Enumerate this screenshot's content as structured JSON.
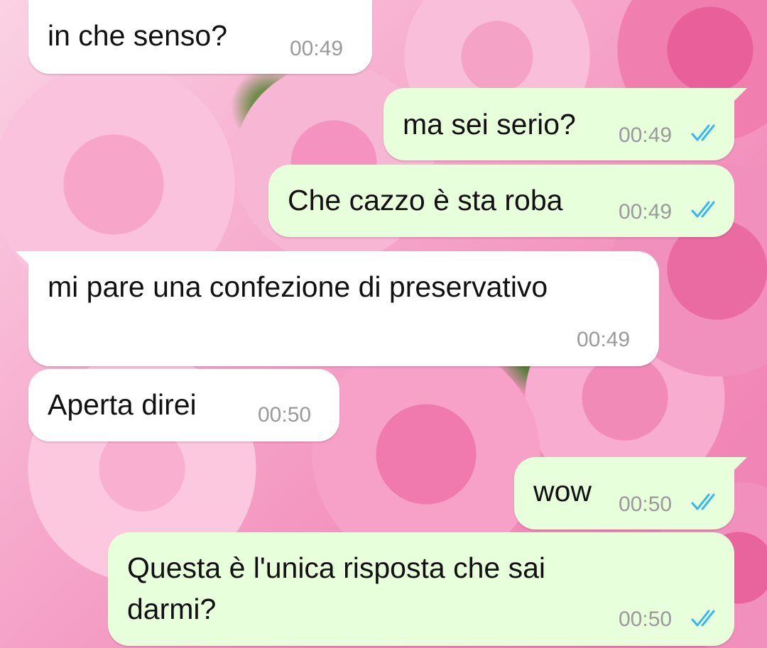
{
  "colors": {
    "incoming_bubble": "#ffffff",
    "outgoing_bubble": "#e7ffdb",
    "read_ticks": "#34b7f1",
    "timestamp": "#9a9a9a"
  },
  "messages": [
    {
      "direction": "incoming",
      "text": "in che senso?",
      "time": "00:49"
    },
    {
      "direction": "outgoing",
      "text": "ma sei serio?",
      "time": "00:49",
      "status": "read-double-check-icon"
    },
    {
      "direction": "outgoing",
      "text": "Che cazzo è sta roba",
      "time": "00:49",
      "status": "read-double-check-icon"
    },
    {
      "direction": "incoming",
      "text": "mi pare una confezione di preservativo",
      "time": "00:49"
    },
    {
      "direction": "incoming",
      "text": "Aperta direi",
      "time": "00:50"
    },
    {
      "direction": "outgoing",
      "text": "wow",
      "time": "00:50",
      "status": "read-double-check-icon"
    },
    {
      "direction": "outgoing",
      "text_lines": [
        "Questa è l'unica risposta che sai",
        "darmi?"
      ],
      "time": "00:50",
      "status": "read-double-check-icon"
    }
  ]
}
